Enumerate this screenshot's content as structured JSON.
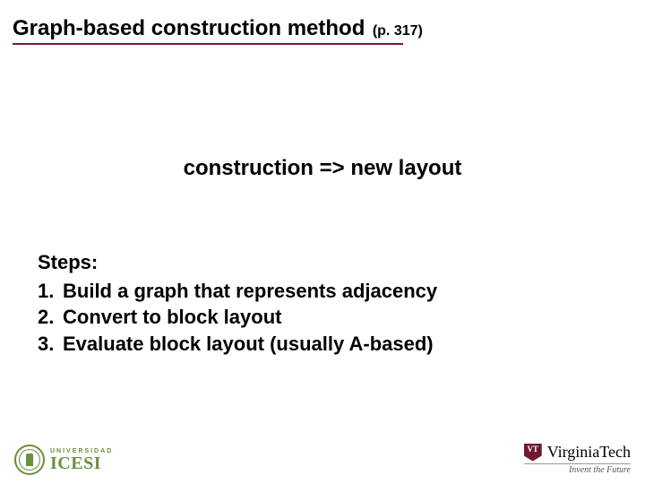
{
  "title": {
    "main": "Graph-based construction method",
    "page_ref": "(p. 317)"
  },
  "center_line": "construction => new layout",
  "steps": {
    "heading": "Steps:",
    "items": [
      {
        "num": "1.",
        "text": "Build a graph that represents adjacency"
      },
      {
        "num": "2.",
        "text": "Convert to block layout"
      },
      {
        "num": "3.",
        "text": "Evaluate block layout (usually A-based)"
      }
    ]
  },
  "footer": {
    "icesi": {
      "top": "UNIVERSIDAD",
      "name": "ICESI"
    },
    "vt": {
      "name": "VirginiaTech",
      "tagline": "Invent the Future"
    }
  }
}
